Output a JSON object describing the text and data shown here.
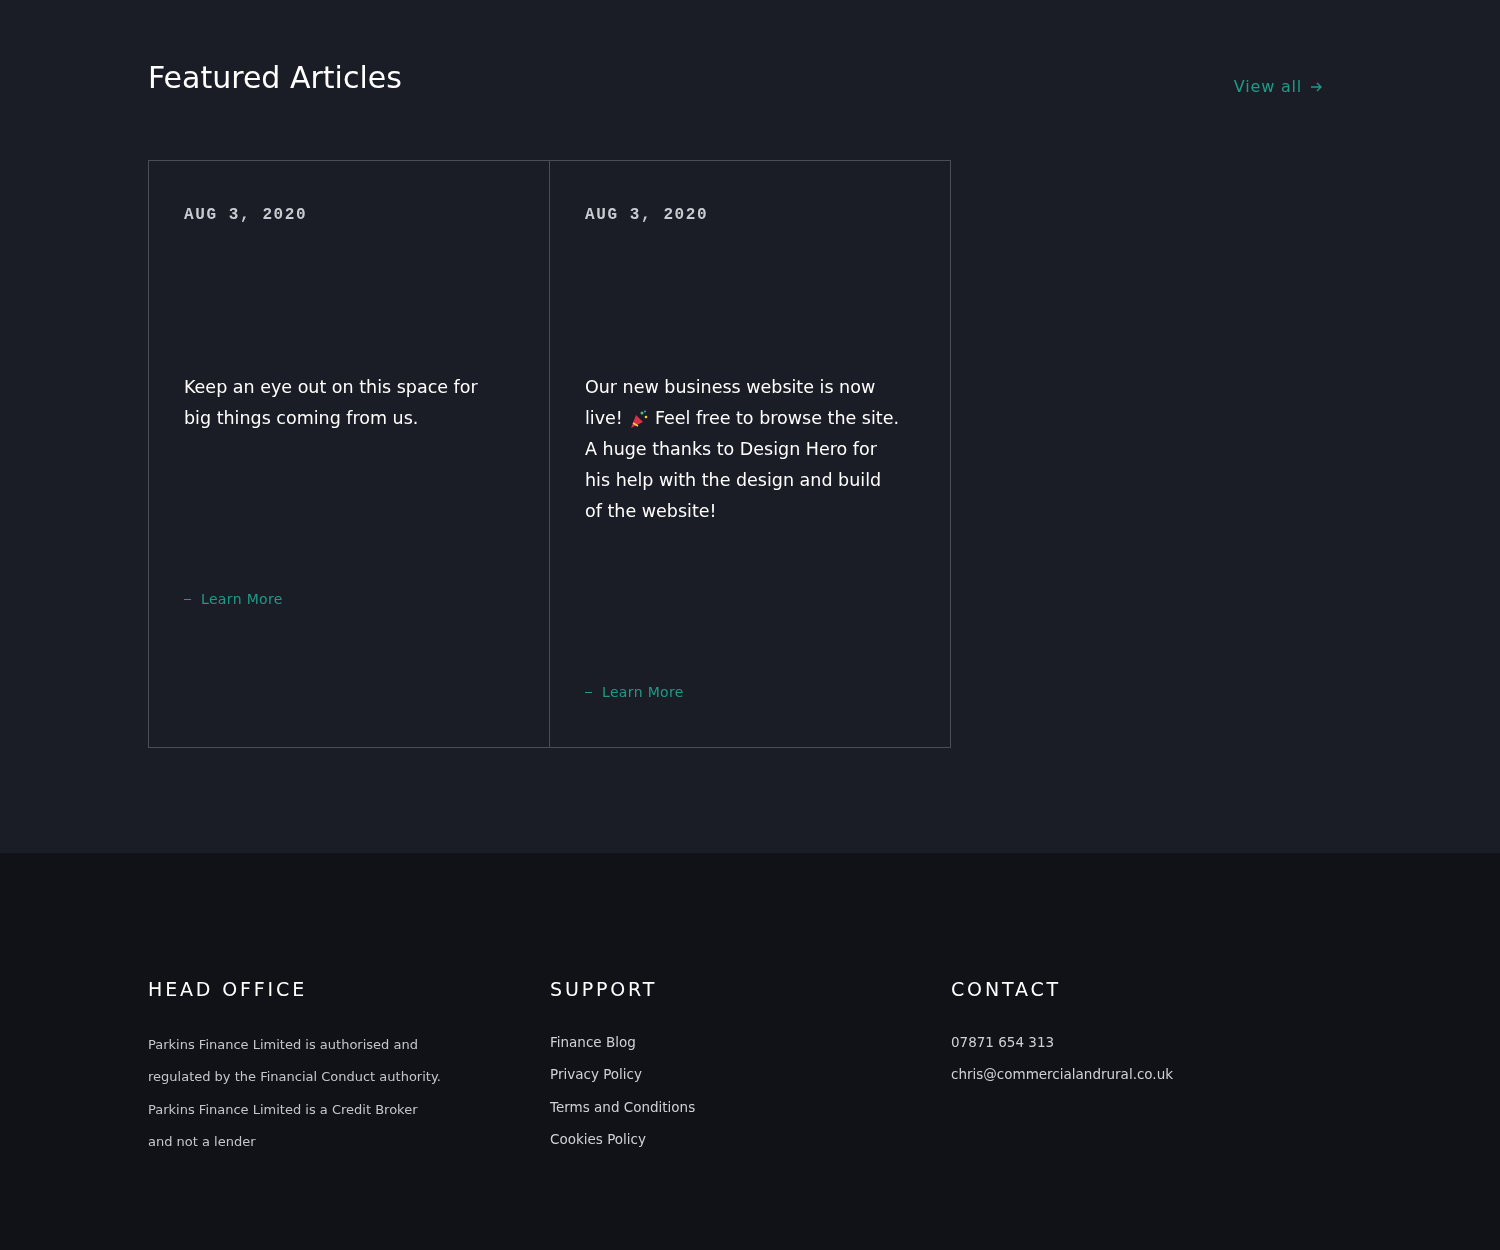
{
  "section_title": "Featured Articles",
  "view_all": {
    "label": "View all"
  },
  "articles": [
    {
      "date": "AUG 3, 2020",
      "body": [
        [
          {
            "kind": "text",
            "text": "Keep an eye out on this space for"
          }
        ],
        [
          {
            "kind": "text",
            "text": "big things coming from us."
          }
        ]
      ],
      "link": "Learn More"
    },
    {
      "date": "AUG 3, 2020",
      "body": [
        [
          {
            "kind": "text",
            "text": "Our new business website is now"
          }
        ],
        [
          {
            "kind": "text",
            "text": "live!"
          },
          {
            "kind": "icon"
          },
          {
            "kind": "text",
            "text": "Feel free to browse the site."
          }
        ],
        [
          {
            "kind": "text",
            "text": "A huge thanks to Design Hero for"
          }
        ],
        [
          {
            "kind": "text",
            "text": "his help with the design and build"
          }
        ],
        [
          {
            "kind": "text",
            "text": "of the website!"
          }
        ]
      ],
      "link": "Learn More"
    }
  ],
  "footer": {
    "columns": [
      {
        "title": "HEAD OFFICE",
        "kind": "paragraph",
        "lines": [
          "Parkins Finance Limited is authorised and",
          "regulated by the Financial Conduct authority.",
          "Parkins Finance Limited is a Credit Broker",
          "and not a lender"
        ]
      },
      {
        "title": "SUPPORT",
        "kind": "links",
        "lines": [
          "Finance Blog",
          "Privacy Policy",
          "Terms and Conditions",
          "Cookies Policy"
        ]
      },
      {
        "title": "CONTACT",
        "kind": "links",
        "lines": [
          "07871 654 313",
          "chris@commercialandrural.co.uk"
        ]
      }
    ]
  }
}
